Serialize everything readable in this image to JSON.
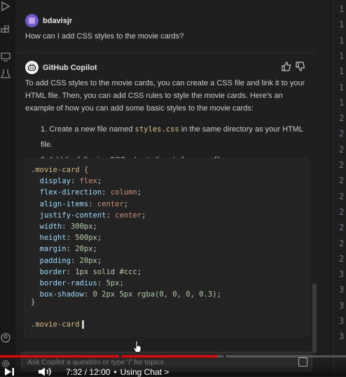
{
  "user": {
    "name": "bdavisjr",
    "question": "How can I add CSS styles to the movie cards?"
  },
  "copilot": {
    "name": "GitHub Copilot",
    "intro": "To add CSS styles to the movie cards, you can create a CSS file and link it to your HTML file. Then, you can add CSS rules to style the movie cards. Here's an example of how you can add some basic styles to the movie cards:",
    "steps": [
      {
        "pre": "Create a new file named ",
        "code": "styles.css",
        "post": " in the same directory as your HTML file."
      },
      {
        "pre": "Add the following CSS rules to the ",
        "code": "styles.css",
        "post": " file:"
      }
    ],
    "code": {
      "selector": ".movie-card {",
      "rules": [
        {
          "prop": "display",
          "value": "flex"
        },
        {
          "prop": "flex-direction",
          "value": "column"
        },
        {
          "prop": "align-items",
          "value": "center"
        },
        {
          "prop": "justify-content",
          "value": "center"
        },
        {
          "prop": "width",
          "value": "300px"
        },
        {
          "prop": "height",
          "value": "500px"
        },
        {
          "prop": "margin",
          "value": "20px"
        },
        {
          "prop": "padding",
          "value": "20px"
        },
        {
          "prop": "border",
          "value": "1px solid #ccc"
        },
        {
          "prop": "border-radius",
          "value": "5px"
        },
        {
          "prop": "box-shadow",
          "value": "0 2px 5px rgba(0, 0, 0, 0.3)"
        }
      ],
      "close": "}",
      "partial": ".movie-card"
    }
  },
  "input": {
    "placeholder": "Ask Copilot a question or type '/' for topics",
    "value": ""
  },
  "line_numbers": [
    "1",
    "1",
    "1",
    "1",
    "1",
    "1",
    "1",
    "2",
    "2",
    "2",
    "2",
    "2",
    "2",
    "2",
    "2",
    "2",
    "2",
    "3",
    "3",
    "3",
    "3",
    "3"
  ],
  "video": {
    "current_time": "7:32",
    "separator": "/",
    "duration": "12:00",
    "bullet": "•",
    "chapter": "Using Chat",
    "chevron": ">",
    "progress_fraction": 0.627,
    "chapter_marks": [
      0.345,
      0.645
    ]
  },
  "colors": {
    "progress": "#ff0000",
    "accent": "#6b5cc9"
  },
  "icons": {
    "activity": [
      "run-debug-icon",
      "extensions-icon",
      "remote-explorer-icon",
      "testing-icon",
      "accounts-icon",
      "settings-icon"
    ],
    "feedback": [
      "thumbs-up-icon",
      "thumbs-down-icon"
    ],
    "player": [
      "next-icon",
      "volume-icon"
    ]
  }
}
